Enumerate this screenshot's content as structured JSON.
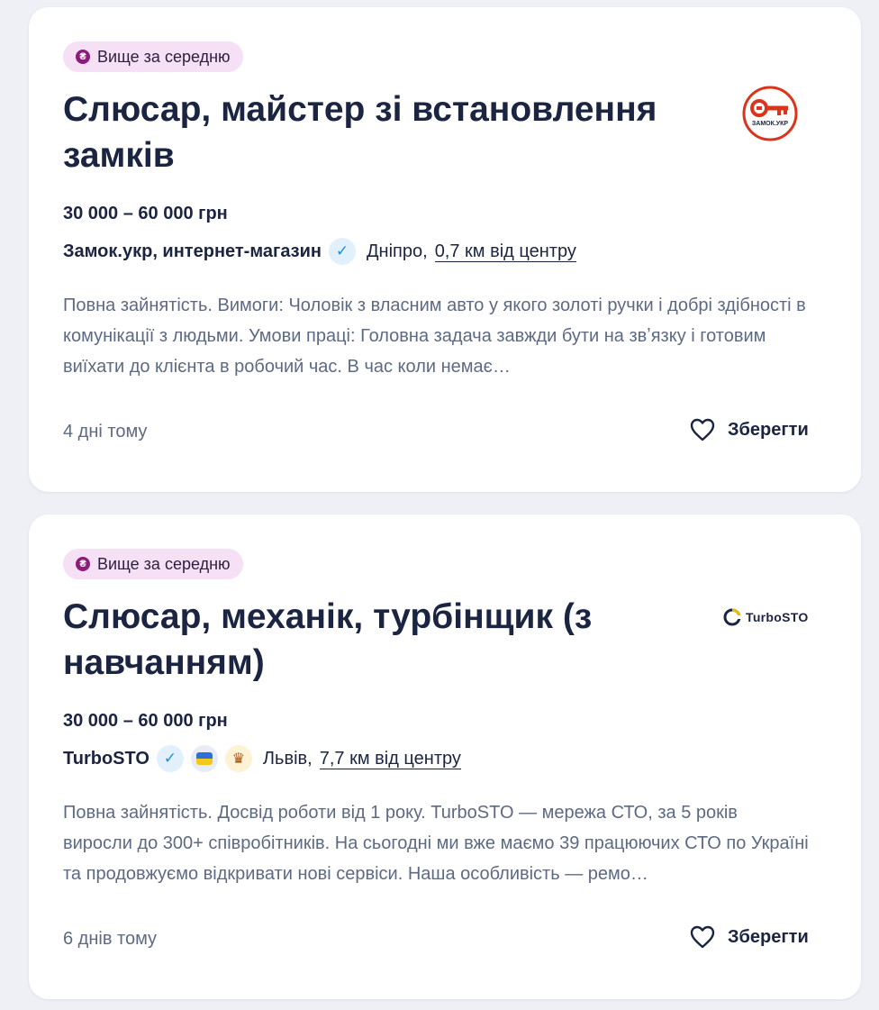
{
  "vacancies": [
    {
      "badge": "Вище за середню",
      "badge_icon": "₴",
      "title": "Слюсар, майстер зі встановлення замків",
      "salary": "30 000 – 60 000 грн",
      "company": "Замок.укр, интернет-магазин",
      "city": "Дніпро,",
      "distance": "0,7 км від центру",
      "description": "Повна зайнятість. Вимоги: Чоловік з власним авто у якого золоті ручки і добрі здібності в комунікації з людьми. Умови праці: Головна задача завжди бути на звʼязку і готовим виїхати до клієнта в робочий час. В час коли немає…",
      "posted": "4 дні тому",
      "save_label": "Зберегти",
      "logo_text": "ЗАМОК.УКР",
      "logo_color": "#d8351c"
    },
    {
      "badge": "Вище за середню",
      "badge_icon": "₴",
      "title": "Слюсар, механік, турбінщик (з навчанням)",
      "salary": "30 000 – 60 000 грн",
      "company": "TurboSTO",
      "city": "Львів,",
      "distance": "7,7 км від центру",
      "description": "Повна зайнятість. Досвід роботи від 1 року. TurboSTO — мережа СТО, за 5 років виросли до 300+ співробітників. На сьогодні ми вже маємо 39 працюючих СТО по Україні та продовжуємо відкривати нові сервіси. Наша особливість — ремо…",
      "posted": "6 днів тому",
      "save_label": "Зберегти",
      "logo_text": "TurboSTO"
    }
  ],
  "colors": {
    "badge_bg": "#f5e0f5",
    "badge_icon": "#8c1c7c",
    "text_dark": "#1b2541",
    "text_muted": "#5d6a83",
    "verified": "#1f8ed6"
  }
}
